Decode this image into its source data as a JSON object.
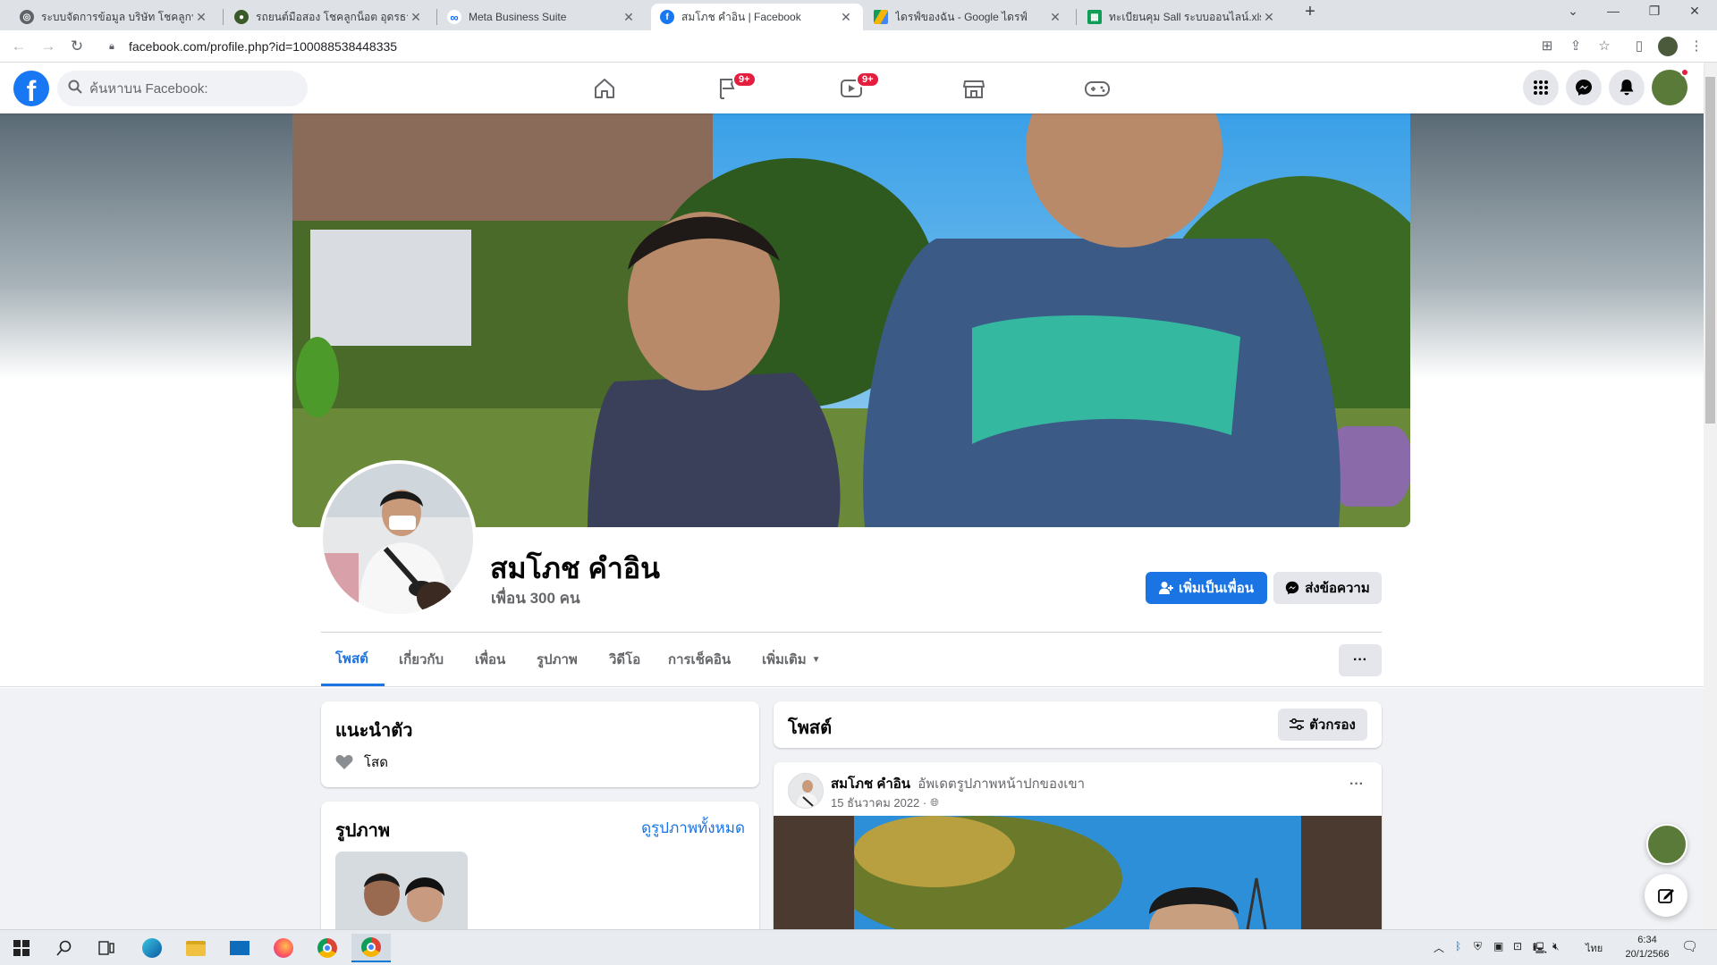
{
  "browser": {
    "tabs": [
      {
        "title": "ระบบจัดการข้อมูล บริษัท โชคลูกน็อต",
        "icon": "globe-icon",
        "active": false
      },
      {
        "title": "รถยนต์มือสอง โชคลูกน็อต อุดรธานี",
        "icon": "site-icon",
        "active": false
      },
      {
        "title": "Meta Business Suite",
        "icon": "meta-icon",
        "active": false
      },
      {
        "title": "สมโภช คำอิน | Facebook",
        "icon": "facebook-icon",
        "active": true
      },
      {
        "title": "ไดรฟ์ของฉัน - Google ไดรฟ์",
        "icon": "drive-icon",
        "active": false
      },
      {
        "title": "ทะเบียนคุม Sall ระบบออนไลน์.xlsx - G",
        "icon": "sheets-icon",
        "active": false
      }
    ],
    "new_tab": "+",
    "url": "facebook.com/profile.php?id=100088538448335"
  },
  "fb_header": {
    "logo": "f",
    "search_placeholder": "ค้นหาบน Facebook:",
    "badges": {
      "groups": "9+",
      "watch": "9+"
    },
    "colors": {
      "brand": "#1877f2",
      "badge": "#e41e3f"
    }
  },
  "profile": {
    "name": "สมโภช คำอิน",
    "friends": "เพื่อน 300 คน",
    "add_friend": "เพิ่มเป็นเพื่อน",
    "send_message": "ส่งข้อความ",
    "tabs": [
      "โพสต์",
      "เกี่ยวกับ",
      "เพื่อน",
      "รูปภาพ",
      "วิดีโอ",
      "การเช็คอิน",
      "เพิ่มเติม"
    ],
    "more_dots": "···"
  },
  "intro": {
    "title": "แนะนำตัว",
    "relationship": "โสด"
  },
  "photos": {
    "title": "รูปภาพ",
    "see_all": "ดูรูปภาพทั้งหมด"
  },
  "posts": {
    "title": "โพสต์",
    "filter": "ตัวกรอง",
    "post": {
      "author": "สมโภช คำอิน",
      "action": "อัพเดตรูปภาพหน้าปกของเขา",
      "date": "15 ธันวาคม 2022 ·",
      "menu": "···"
    }
  },
  "taskbar": {
    "lang": "ไทย",
    "time": "6:34",
    "date": "20/1/2566"
  }
}
